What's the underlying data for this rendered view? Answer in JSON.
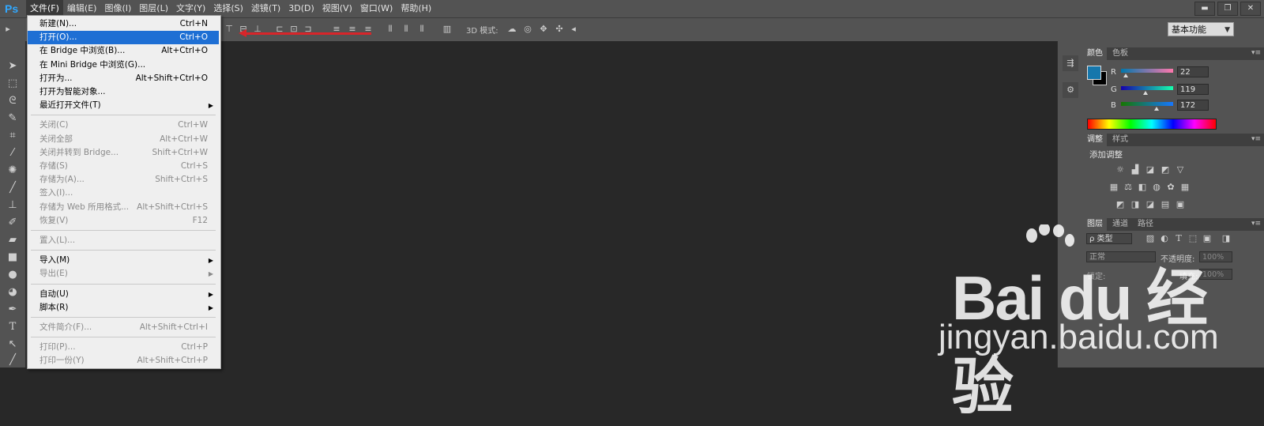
{
  "app": {
    "logo": "Ps",
    "menus": [
      "文件(F)",
      "编辑(E)",
      "图像(I)",
      "图层(L)",
      "文字(Y)",
      "选择(S)",
      "滤镜(T)",
      "3D(D)",
      "视图(V)",
      "窗口(W)",
      "帮助(H)"
    ],
    "active_menu": "文件(F)",
    "window_controls": [
      "▬",
      "❐",
      "✕"
    ]
  },
  "options_bar": {
    "mode3d_label": "3D 模式:",
    "workspace": "基本功能"
  },
  "file_menu": {
    "items": [
      {
        "label": "新建(N)...",
        "shortcut": "Ctrl+N",
        "disabled": false,
        "submenu": false
      },
      {
        "label": "打开(O)...",
        "shortcut": "Ctrl+O",
        "disabled": false,
        "submenu": false,
        "highlighted": true
      },
      {
        "label": "在 Bridge 中浏览(B)...",
        "shortcut": "Alt+Ctrl+O",
        "disabled": false,
        "submenu": false
      },
      {
        "label": "在 Mini Bridge 中浏览(G)...",
        "shortcut": "",
        "disabled": false,
        "submenu": false
      },
      {
        "label": "打开为...",
        "shortcut": "Alt+Shift+Ctrl+O",
        "disabled": false,
        "submenu": false
      },
      {
        "label": "打开为智能对象...",
        "shortcut": "",
        "disabled": false,
        "submenu": false
      },
      {
        "label": "最近打开文件(T)",
        "shortcut": "",
        "disabled": false,
        "submenu": true
      },
      {
        "label": "关闭(C)",
        "shortcut": "Ctrl+W",
        "disabled": true,
        "submenu": false
      },
      {
        "label": "关闭全部",
        "shortcut": "Alt+Ctrl+W",
        "disabled": true,
        "submenu": false
      },
      {
        "label": "关闭并转到 Bridge...",
        "shortcut": "Shift+Ctrl+W",
        "disabled": true,
        "submenu": false
      },
      {
        "label": "存储(S)",
        "shortcut": "Ctrl+S",
        "disabled": true,
        "submenu": false
      },
      {
        "label": "存储为(A)...",
        "shortcut": "Shift+Ctrl+S",
        "disabled": true,
        "submenu": false
      },
      {
        "label": "签入(I)...",
        "shortcut": "",
        "disabled": true,
        "submenu": false
      },
      {
        "label": "存储为 Web 所用格式...",
        "shortcut": "Alt+Shift+Ctrl+S",
        "disabled": true,
        "submenu": false
      },
      {
        "label": "恢复(V)",
        "shortcut": "F12",
        "disabled": true,
        "submenu": false
      },
      {
        "label": "置入(L)...",
        "shortcut": "",
        "disabled": true,
        "submenu": false
      },
      {
        "label": "导入(M)",
        "shortcut": "",
        "disabled": false,
        "submenu": true
      },
      {
        "label": "导出(E)",
        "shortcut": "",
        "disabled": true,
        "submenu": true
      },
      {
        "label": "自动(U)",
        "shortcut": "",
        "disabled": false,
        "submenu": true
      },
      {
        "label": "脚本(R)",
        "shortcut": "",
        "disabled": false,
        "submenu": true
      },
      {
        "label": "文件简介(F)...",
        "shortcut": "Alt+Shift+Ctrl+I",
        "disabled": true,
        "submenu": false
      },
      {
        "label": "打印(P)...",
        "shortcut": "Ctrl+P",
        "disabled": true,
        "submenu": false
      },
      {
        "label": "打印一份(Y)",
        "shortcut": "Alt+Shift+Ctrl+P",
        "disabled": true,
        "submenu": false
      }
    ],
    "submenu_glyph": "▶"
  },
  "color_panel": {
    "tabs": [
      "颜色",
      "色板"
    ],
    "labels": [
      "R",
      "G",
      "B"
    ],
    "values": [
      "22",
      "119",
      "172"
    ],
    "fraction": [
      0.086,
      0.467,
      0.675
    ],
    "foreground": "#1677ac",
    "background": "#000000"
  },
  "adjust_panel": {
    "tabs": [
      "调整",
      "样式"
    ],
    "title": "添加调整"
  },
  "layers_panel": {
    "tabs": [
      "图层",
      "通道",
      "路径"
    ],
    "filter": "ρ 类型",
    "blend": "正常",
    "opacity_label": "不透明度:",
    "opacity": "100%",
    "lock_label": "锁定:",
    "fill_label": "填充:",
    "fill": "100%"
  },
  "watermark": {
    "brand": "Bai du 经验",
    "url": "jingyan.baidu.com"
  }
}
